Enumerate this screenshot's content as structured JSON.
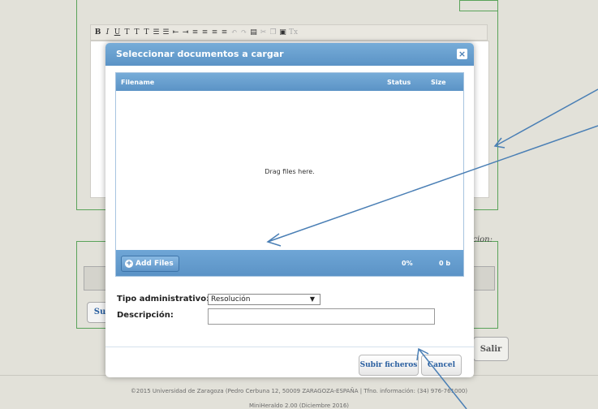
{
  "editor_toolbar": {
    "buttons": [
      "B",
      "I",
      "U",
      "T",
      "T",
      "T",
      "☰",
      "☰",
      "⇤",
      "⇥",
      "≡",
      "≡",
      "≡",
      "≡",
      "↶",
      "↷",
      "▤",
      "✂",
      "❐",
      "▣",
      "Tx"
    ]
  },
  "background": {
    "legend_right": "cion:",
    "su_button_label": "Su",
    "salir_label": "Salir"
  },
  "modal": {
    "title": "Seleccionar documentos a cargar",
    "close_label": "×",
    "uploader": {
      "col_filename": "Filename",
      "col_status": "Status",
      "col_size": "Size",
      "drop_text": "Drag files here.",
      "add_files_label": "Add Files",
      "percent": "0%",
      "size_total": "0 b"
    },
    "form": {
      "tipo_label": "Tipo administrativo:",
      "tipo_value": "Resolución",
      "desc_label": "Descripción:",
      "desc_value": ""
    },
    "buttons": {
      "submit_label": "Subir ficheros",
      "cancel_label": "Cancel"
    }
  },
  "footer": {
    "line1": "©2015 Universidad de Zaragoza (Pedro Cerbuna 12, 50009 ZARAGOZA-ESPAÑA | Tfno. información: (34) 976-761000)",
    "line2": "MiniHeraldo 2.00 (Diciembre 2016)"
  },
  "colors": {
    "accent": "#5b93c6",
    "arrow": "#4a7fb5",
    "frame": "#5aa35a"
  }
}
